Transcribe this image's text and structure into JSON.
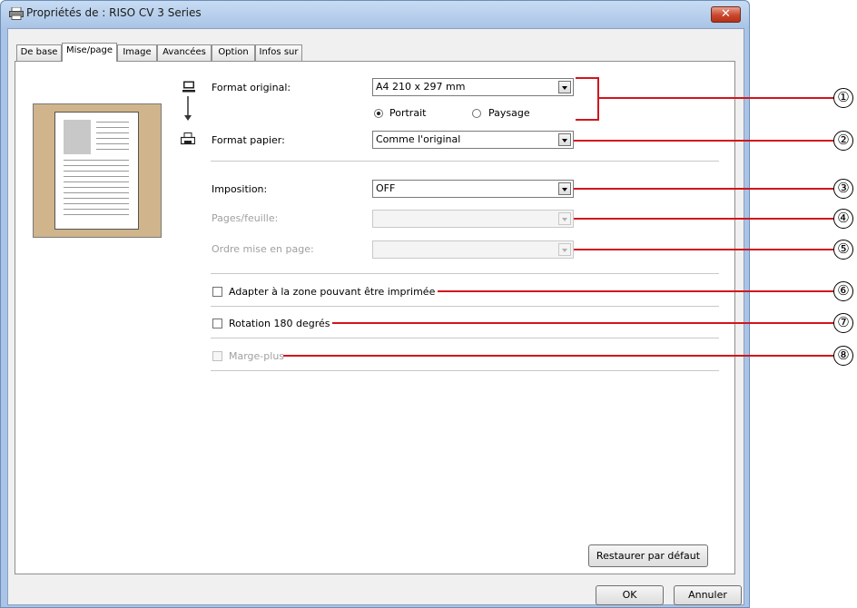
{
  "window": {
    "title": "Propriétés de : RISO CV 3 Series",
    "close_label": "✕"
  },
  "tabs": [
    {
      "label": "De base",
      "active": false
    },
    {
      "label": "Mise/page",
      "active": true
    },
    {
      "label": "Image",
      "active": false
    },
    {
      "label": "Avancées",
      "active": false
    },
    {
      "label": "Option",
      "active": false
    },
    {
      "label": "Infos sur",
      "active": false
    }
  ],
  "format_original": {
    "label": "Format original:",
    "value": "A4 210 x 297 mm",
    "icon": "monitor-icon"
  },
  "orientation": {
    "portrait_label": "Portrait",
    "paysage_label": "Paysage",
    "selected": "Portrait"
  },
  "format_papier": {
    "label": "Format papier:",
    "value": "Comme l'original",
    "icon": "printer-icon"
  },
  "imposition": {
    "label": "Imposition:",
    "value": "OFF"
  },
  "pages_feuille": {
    "label": "Pages/feuille:",
    "value": ""
  },
  "ordre_mise_en_page": {
    "label": "Ordre mise en page:",
    "value": ""
  },
  "checkboxes": {
    "adapter_label": "Adapter à la zone pouvant être imprimée",
    "adapter_checked": false,
    "rotation_label": "Rotation 180 degrés",
    "rotation_checked": false,
    "marge_label": "Marge-plus",
    "marge_checked": false
  },
  "buttons": {
    "restore_label": "Restaurer par défaut",
    "ok_label": "OK",
    "cancel_label": "Annuler"
  },
  "callouts": [
    "①",
    "②",
    "③",
    "④",
    "⑤",
    "⑥",
    "⑦",
    "⑧"
  ],
  "colors": {
    "callout_line": "#d2151c",
    "preview_background": "#cfb48c",
    "title_bar": "#a9c4e6"
  }
}
